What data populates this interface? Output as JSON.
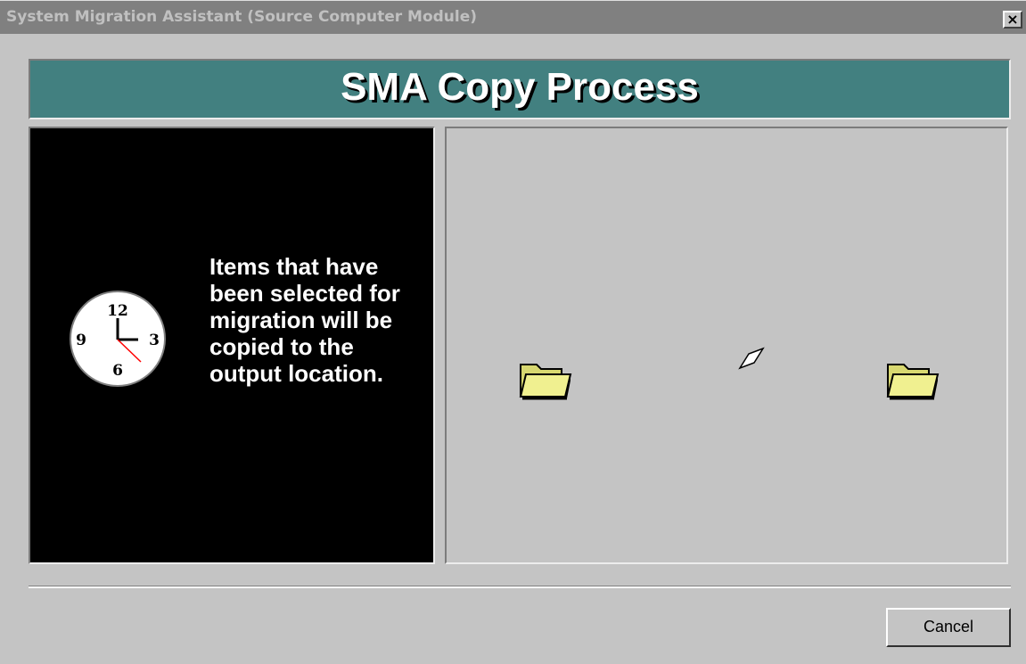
{
  "window": {
    "title": "System Migration Assistant (Source Computer Module)",
    "close_glyph": "✕"
  },
  "banner": {
    "heading": "SMA Copy Process",
    "color": "#428080"
  },
  "status_panel": {
    "clock_numbers": [
      "12",
      "3",
      "6",
      "9"
    ],
    "message": "Items that have been selected for migration will be copied to the output location."
  },
  "animation_panel": {
    "source_icon": "folder-icon",
    "moving_icon": "paper-icon",
    "destination_icon": "folder-icon"
  },
  "footer": {
    "cancel_label": "Cancel"
  }
}
